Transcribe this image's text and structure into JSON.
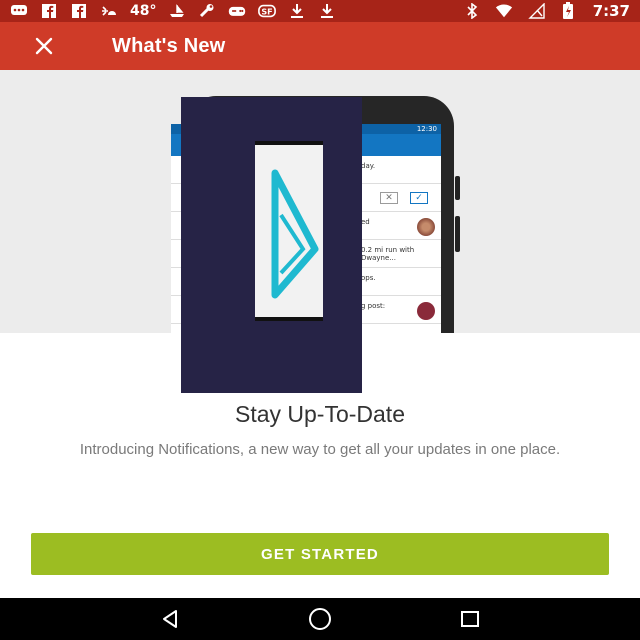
{
  "status_bar": {
    "temperature": "48°",
    "time": "7:37",
    "icons": [
      "messages-icon",
      "facebook-icon",
      "facebook-icon",
      "weather-icon",
      "boat-icon",
      "wrench-icon",
      "gamepad-icon",
      "app-icon",
      "download-icon",
      "download-icon",
      "bluetooth-icon",
      "wifi-icon",
      "no-signal-icon",
      "battery-icon"
    ]
  },
  "appbar": {
    "title": "What's New",
    "close_icon": "close-icon"
  },
  "hero": {
    "phone_status_time": "12:30",
    "phone_rows": [
      "day.",
      "",
      "ed",
      "0.2 mi run with Dwayne...",
      "ops.",
      "g post:"
    ]
  },
  "content": {
    "heading": "Stay Up-To-Date",
    "description": "Introducing Notifications, a new way to get all your updates in one place."
  },
  "cta": {
    "label": "GET STARTED",
    "color": "#9cbd22"
  },
  "nav": {
    "icons": [
      "back-icon",
      "home-icon",
      "recents-icon"
    ]
  },
  "colors": {
    "status_bar": "#a72418",
    "app_bar": "#cf3b28",
    "cta": "#9cbd22",
    "logo_cyan": "#1fb9d0"
  }
}
